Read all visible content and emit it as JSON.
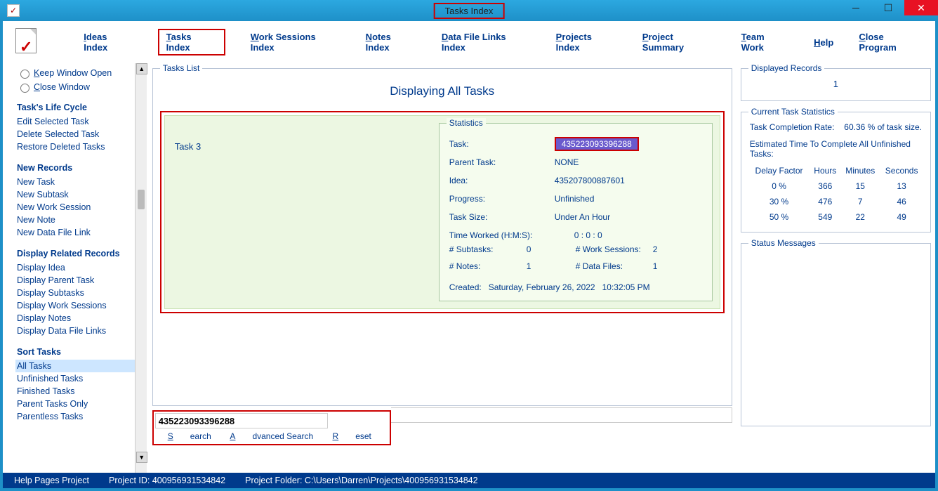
{
  "window": {
    "title": "Tasks Index"
  },
  "nav": {
    "ideas": "Ideas Index",
    "tasks": "Tasks Index",
    "work": "Work Sessions Index",
    "notes": "Notes Index",
    "datafiles": "Data File Links Index",
    "projects": "Projects Index",
    "summary": "Project Summary",
    "team": "Team Work",
    "help": "Help",
    "close": "Close Program"
  },
  "sidebar": {
    "radio_keep": "Keep Window Open",
    "radio_close": "Close Window",
    "life_head": "Task's Life Cycle",
    "life": [
      "Edit Selected Task",
      "Delete Selected Task",
      "Restore Deleted Tasks"
    ],
    "new_head": "New Records",
    "newrec": [
      "New Task",
      "New Subtask",
      "New Work Session",
      "New Note",
      "New Data File Link"
    ],
    "disp_head": "Display Related Records",
    "disp": [
      "Display Idea",
      "Display Parent Task",
      "Display Subtasks",
      "Display Work Sessions",
      "Display Notes",
      "Display Data File Links"
    ],
    "sort_head": "Sort Tasks",
    "sort": [
      "All Tasks",
      "Unfinished Tasks",
      "Finished Tasks",
      "Parent Tasks Only",
      "Parentless Tasks"
    ],
    "sort_selected_index": 0
  },
  "tasks_list": {
    "legend": "Tasks List",
    "heading": "Displaying All Tasks",
    "task_name": "Task 3",
    "stats": {
      "legend": "Statistics",
      "rows": {
        "task_lbl": "Task:",
        "task_val": "435223093396288",
        "parent_lbl": "Parent Task:",
        "parent_val": "NONE",
        "idea_lbl": "Idea:",
        "idea_val": "435207800887601",
        "prog_lbl": "Progress:",
        "prog_val": "Unfinished",
        "size_lbl": "Task Size:",
        "size_val": "Under An Hour",
        "tw_lbl": "Time Worked (H:M:S):",
        "tw_val": "0 :  0  :  0",
        "sub_lbl": "# Subtasks:",
        "sub_val": "0",
        "ws_lbl": "# Work Sessions:",
        "ws_val": "2",
        "notes_lbl": "# Notes:",
        "notes_val": "1",
        "df_lbl": "# Data Files:",
        "df_val": "1",
        "created_lbl": "Created:",
        "created_date": "Saturday, February 26, 2022",
        "created_time": "10:32:05 PM"
      }
    }
  },
  "search": {
    "value": "435223093396288",
    "search": "Search",
    "advanced": "Advanced Search",
    "reset": "Reset"
  },
  "right": {
    "disp_legend": "Displayed Records",
    "disp_count": "1",
    "cur_legend": "Current Task Statistics",
    "completion_lbl": "Task Completion Rate:",
    "completion_val": "60.36 % of task size.",
    "est_head": "Estimated Time To Complete All Unfinished Tasks:",
    "cols": {
      "delay": "Delay Factor",
      "hours": "Hours",
      "minutes": "Minutes",
      "seconds": "Seconds"
    },
    "rows": [
      {
        "delay": "0 %",
        "hours": "366",
        "minutes": "15",
        "seconds": "13"
      },
      {
        "delay": "30 %",
        "hours": "476",
        "minutes": "7",
        "seconds": "46"
      },
      {
        "delay": "50 %",
        "hours": "549",
        "minutes": "22",
        "seconds": "49"
      }
    ],
    "status_legend": "Status Messages"
  },
  "status": {
    "help": "Help Pages Project",
    "pid_lbl": "Project ID:",
    "pid": "400956931534842",
    "folder_lbl": "Project Folder:",
    "folder": "C:\\Users\\Darren\\Projects\\400956931534842"
  }
}
